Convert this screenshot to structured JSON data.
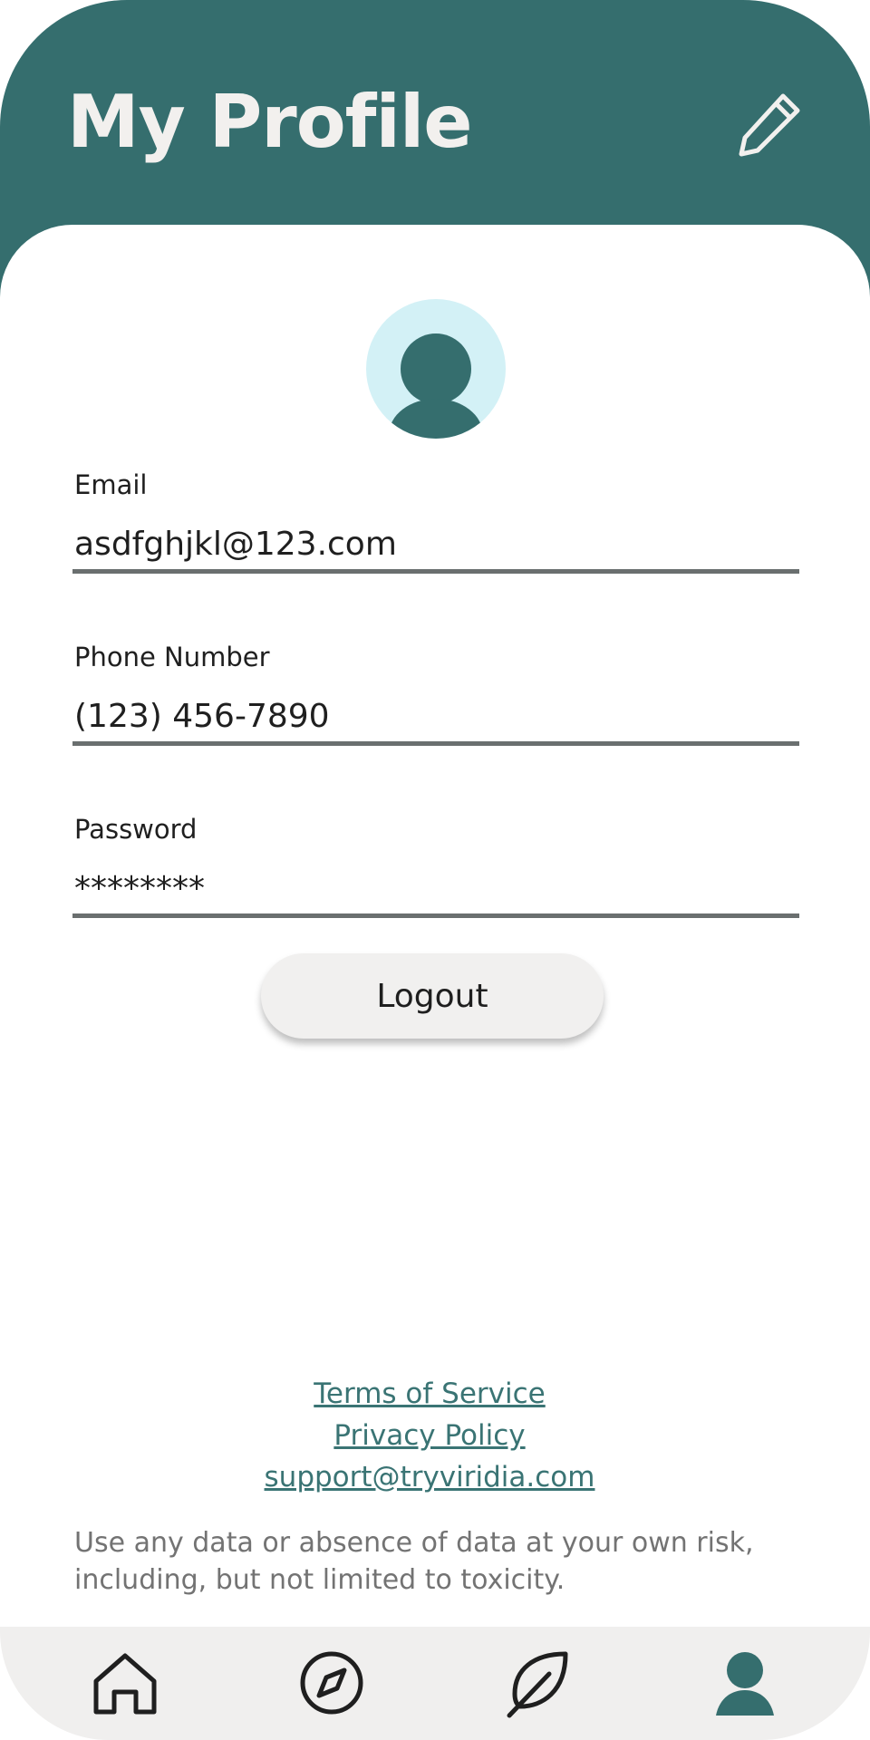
{
  "header": {
    "title": "My Profile",
    "edit_icon": "pencil-icon"
  },
  "profile": {
    "avatar_icon": "user-avatar-icon"
  },
  "fields": {
    "email": {
      "label": "Email",
      "value": "asdfghjkl@123.com"
    },
    "phone": {
      "label": "Phone Number",
      "value": "(123) 456-7890"
    },
    "password": {
      "label": "Password",
      "value": "********"
    }
  },
  "actions": {
    "logout_label": "Logout"
  },
  "footer": {
    "terms_label": "Terms of Service",
    "privacy_label": "Privacy Policy",
    "support_email": "support@tryviridia.com",
    "disclaimer": "Use any data or absence of data at your own risk, including, but not limited to toxicity."
  },
  "nav": {
    "items": [
      {
        "name": "home",
        "icon": "home-icon",
        "active": false
      },
      {
        "name": "explore",
        "icon": "compass-icon",
        "active": false
      },
      {
        "name": "plants",
        "icon": "leaf-icon",
        "active": false
      },
      {
        "name": "profile",
        "icon": "profile-icon",
        "active": true
      }
    ]
  },
  "colors": {
    "header": "#356e6e",
    "accent": "#356e6e",
    "avatar_bg": "#d3f1f6",
    "link": "#3a7474",
    "nav_bg": "#f0efee"
  }
}
